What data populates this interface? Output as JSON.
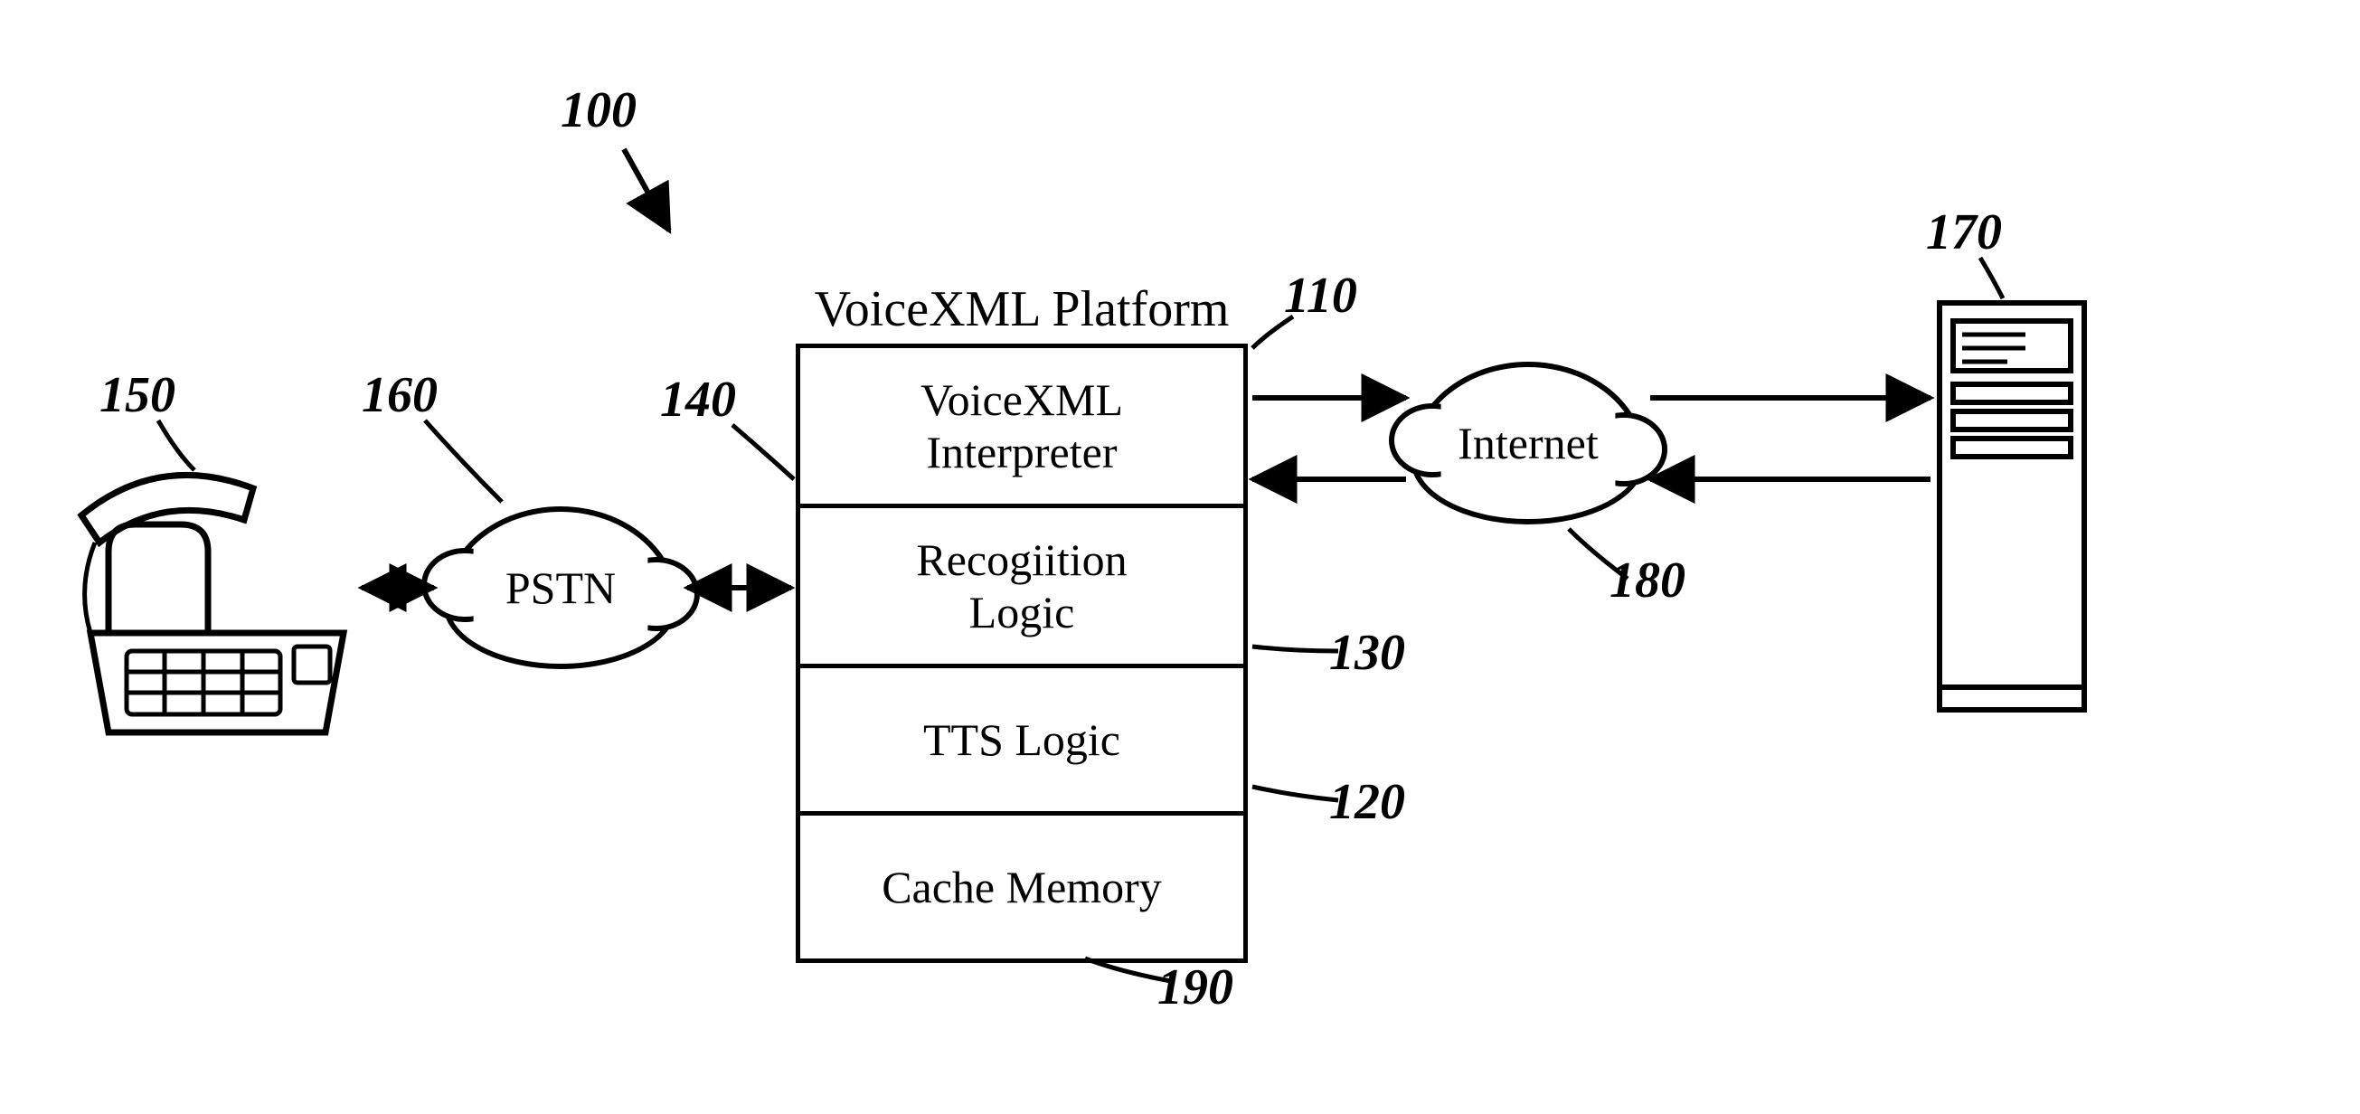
{
  "figure": {
    "system_ref": "100",
    "platform_title": "VoiceXML Platform",
    "platform_ref": "110",
    "platform_rows": {
      "interpreter": {
        "label": "VoiceXML\nInterpreter",
        "ref": "140"
      },
      "recognition": {
        "label": "Recogiition\nLogic",
        "ref": "130"
      },
      "tts": {
        "label": "TTS Logic",
        "ref": "120"
      },
      "cache": {
        "label": "Cache Memory",
        "ref": "190"
      }
    },
    "pstn": {
      "label": "PSTN",
      "ref": "160"
    },
    "internet": {
      "label": "Internet",
      "ref": "180"
    },
    "phone": {
      "ref": "150"
    },
    "server": {
      "ref": "170"
    }
  }
}
